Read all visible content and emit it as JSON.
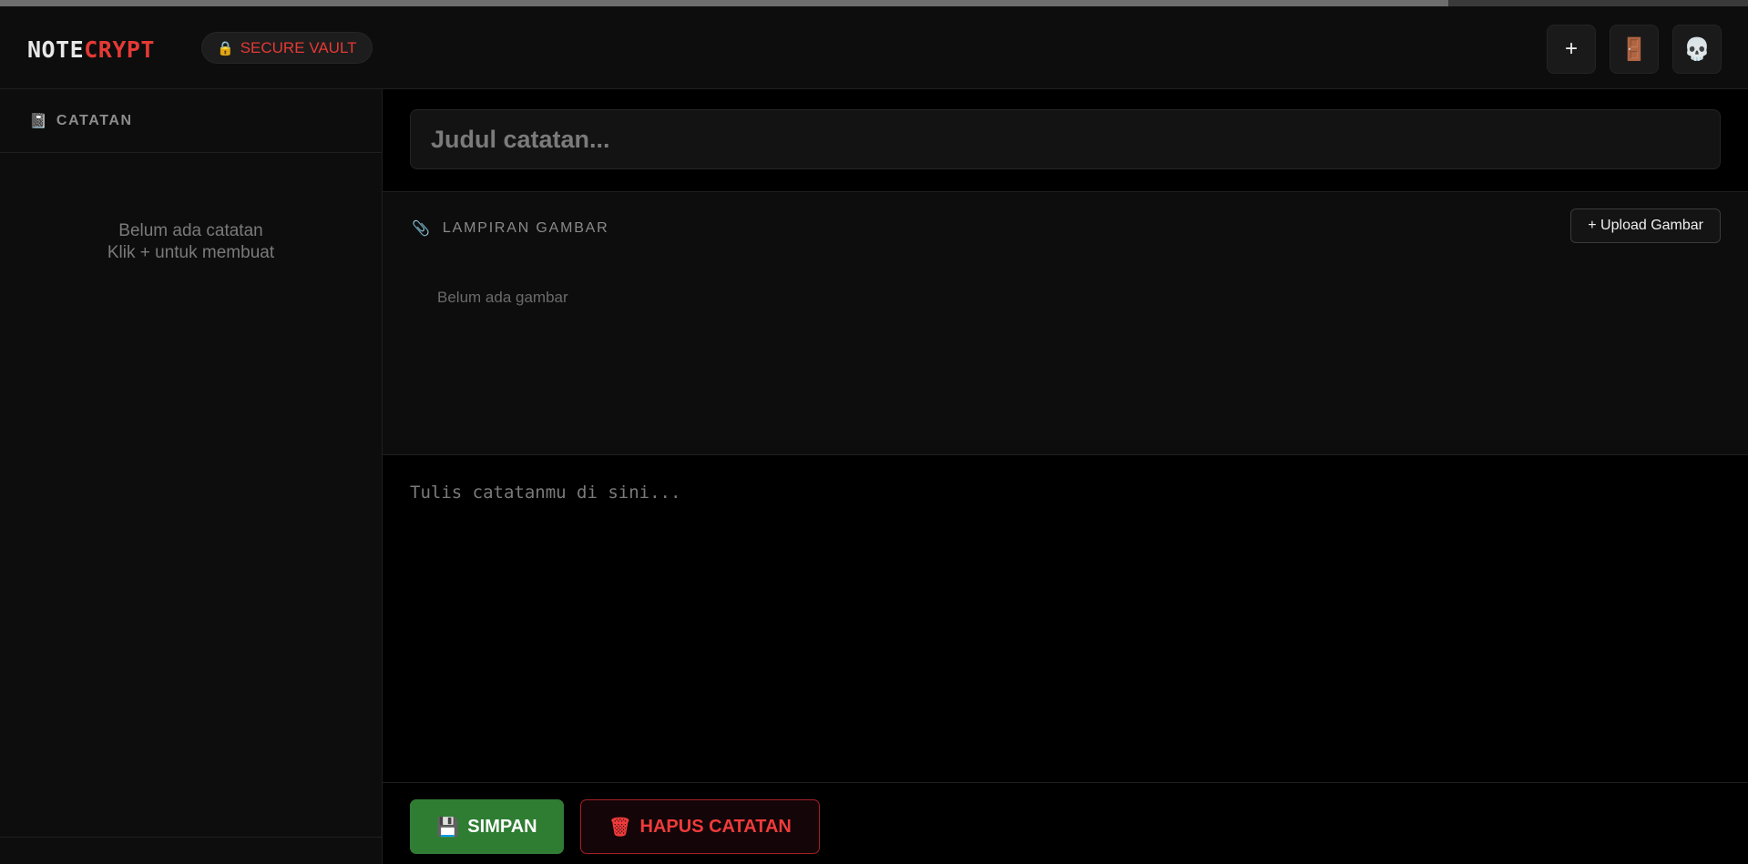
{
  "app": {
    "logo_part1": "NOTE",
    "logo_part2": "CRYPT",
    "badge_icon": "🔒",
    "badge_text": "SECURE VAULT"
  },
  "header_buttons": {
    "new_note": "+",
    "door": "🚪",
    "skull": "💀"
  },
  "sidebar": {
    "icon": "📓",
    "title": "CATATAN",
    "empty_line1": "Belum ada catatan",
    "empty_line2": "Klik + untuk membuat"
  },
  "editor": {
    "title_placeholder": "Judul catatan...",
    "attach_icon": "📎",
    "attach_title": "LAMPIRAN GAMBAR",
    "upload_label": "+ Upload Gambar",
    "no_images": "Belum ada gambar",
    "body_placeholder": "Tulis catatanmu di sini..."
  },
  "actions": {
    "save_icon": "💾",
    "save_label": "SIMPAN",
    "delete_icon": "🗑",
    "delete_label": "HAPUS CATATAN"
  },
  "colors": {
    "accent_red": "#e53935",
    "save_green": "#2e7d32"
  }
}
